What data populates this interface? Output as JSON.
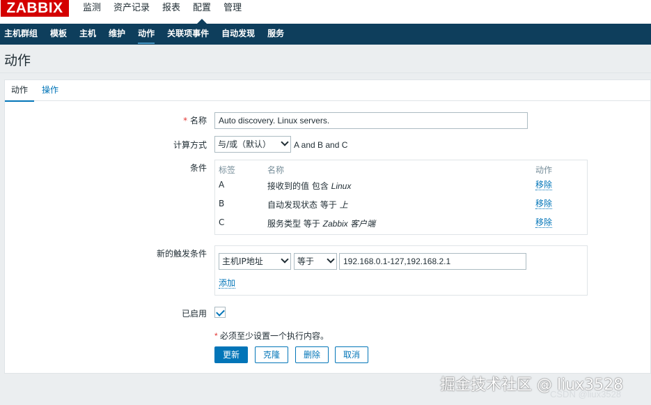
{
  "logo": "ZABBIX",
  "top_nav": [
    "监测",
    "资产记录",
    "报表",
    "配置",
    "管理"
  ],
  "sub_nav": [
    "主机群组",
    "模板",
    "主机",
    "维护",
    "动作",
    "关联项事件",
    "自动发现",
    "服务"
  ],
  "page_title": "动作",
  "tabs": [
    "动作",
    "操作"
  ],
  "form": {
    "name_label": "名称",
    "name_value": "Auto discovery. Linux servers.",
    "calc_label": "计算方式",
    "calc_value": "与/或（默认）",
    "calc_expr": "A and B and C",
    "conditions_label": "条件",
    "conditions_headers": {
      "label": "标签",
      "name": "名称",
      "action": "动作"
    },
    "conditions": [
      {
        "label": "A",
        "text": "接收到的值 包含 ",
        "value": "Linux",
        "remove": "移除"
      },
      {
        "label": "B",
        "text": "自动发现状态 等于 ",
        "value": "上",
        "remove": "移除"
      },
      {
        "label": "C",
        "text": "服务类型 等于 ",
        "value": "Zabbix 客户端",
        "remove": "移除"
      }
    ],
    "new_condition_label": "新的触发条件",
    "new_condition_type": "主机IP地址",
    "new_condition_op": "等于",
    "new_condition_value": "192.168.0.1-127,192.168.2.1",
    "add_link": "添加",
    "enabled_label": "已启用",
    "enabled": true,
    "note": "必须至少设置一个执行内容。"
  },
  "buttons": {
    "update": "更新",
    "clone": "克隆",
    "delete": "删除",
    "cancel": "取消"
  },
  "watermark_main": "掘金技术社区 @ liux3528",
  "watermark_sub": "CSDN @liux3528",
  "colors": {
    "brand": "#d40000",
    "navbar": "#0e3e5c",
    "accent": "#0275b8",
    "required": "#e33734"
  }
}
